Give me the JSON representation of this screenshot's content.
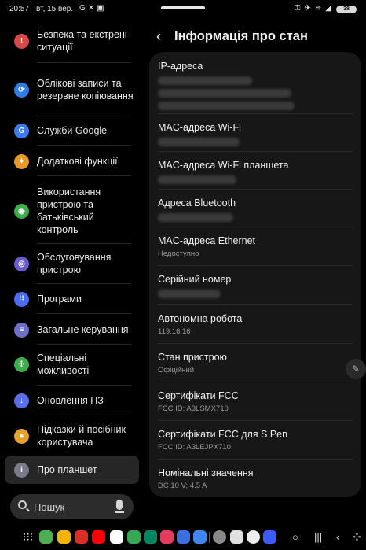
{
  "status_bar": {
    "time": "20:57",
    "date": "вт, 15 вер.",
    "left_icons": [
      "G",
      "✕",
      "▣"
    ],
    "right_icons": [
      "⚿",
      "✈",
      "≋",
      "◢"
    ],
    "battery": "38"
  },
  "sidebar": {
    "items": [
      {
        "label": "Безпека та екстрені ситуації",
        "icon": "emergency-icon",
        "color": "#d84848"
      },
      {
        "label": "Облікові записи та резервне копіювання",
        "icon": "sync-icon",
        "color": "#2f7de8"
      },
      {
        "label": "Служби Google",
        "icon": "google-icon",
        "color": "#3b7cf0"
      },
      {
        "label": "Додаткові функції",
        "icon": "star-icon",
        "color": "#e79a2a"
      },
      {
        "label": "Використання пристрою та батьківський контроль",
        "icon": "wellbeing-icon",
        "color": "#3dae4a"
      },
      {
        "label": "Обслуговування пристрою",
        "icon": "care-icon",
        "color": "#6a5acd"
      },
      {
        "label": "Програми",
        "icon": "apps-icon",
        "color": "#4a6cf0"
      },
      {
        "label": "Загальне керування",
        "icon": "sliders-icon",
        "color": "#6d6fc9"
      },
      {
        "label": "Спеціальні можливості",
        "icon": "accessibility-icon",
        "color": "#3bae4a"
      },
      {
        "label": "Оновлення ПЗ",
        "icon": "update-icon",
        "color": "#5a6ee8"
      },
      {
        "label": "Підказки й посібник користувача",
        "icon": "bulb-icon",
        "color": "#e4a12b"
      },
      {
        "label": "Про планшет",
        "icon": "info-icon",
        "color": "#7a7a8a"
      }
    ],
    "search_placeholder": "Пошук"
  },
  "detail": {
    "title": "Інформація про стан",
    "rows": [
      {
        "title": "IP-адреса",
        "value": ""
      },
      {
        "title": "MAC-адреса Wi-Fi",
        "value": ""
      },
      {
        "title": "MAC-адреса Wi-Fi планшета",
        "value": ""
      },
      {
        "title": "Адреса Bluetooth",
        "value": ""
      },
      {
        "title": "MAC-адреса Ethernet",
        "value": "Недоступно"
      },
      {
        "title": "Серійний номер",
        "value": ""
      },
      {
        "title": "Автономна робота",
        "value": "119:16:16"
      },
      {
        "title": "Стан пристрою",
        "value": "Офіційний"
      },
      {
        "title": "Сертифікати FCC",
        "value": "FCC ID: A3LSMX710"
      },
      {
        "title": "Сертифікати FCC для S Pen",
        "value": "FCC ID: A3LEJPX710"
      },
      {
        "title": "Номінальні значення",
        "value": "DC 10 V; 4.5 A"
      }
    ]
  },
  "taskbar": {
    "apps": [
      {
        "name": "google-app",
        "color": "#4caf50"
      },
      {
        "name": "keep-app",
        "color": "#f4b400"
      },
      {
        "name": "pdf-app",
        "color": "#d93025"
      },
      {
        "name": "youtube-app",
        "color": "#ff0000"
      },
      {
        "name": "photos-app",
        "color": "#ffffff"
      },
      {
        "name": "chrome-app",
        "color": "#34a853"
      },
      {
        "name": "play-store-app",
        "color": "#01875f"
      },
      {
        "name": "gallery-app",
        "color": "#e33b5c"
      },
      {
        "name": "notes-app",
        "color": "#3b6fe0"
      },
      {
        "name": "translate-app",
        "color": "#4285f4"
      },
      {
        "name": "settings-app",
        "color": "#8a8a8a"
      },
      {
        "name": "files-app",
        "color": "#e0e0e0"
      },
      {
        "name": "openai-app",
        "color": "#eeeeee"
      },
      {
        "name": "ai-app",
        "color": "#3d5afe"
      }
    ]
  }
}
